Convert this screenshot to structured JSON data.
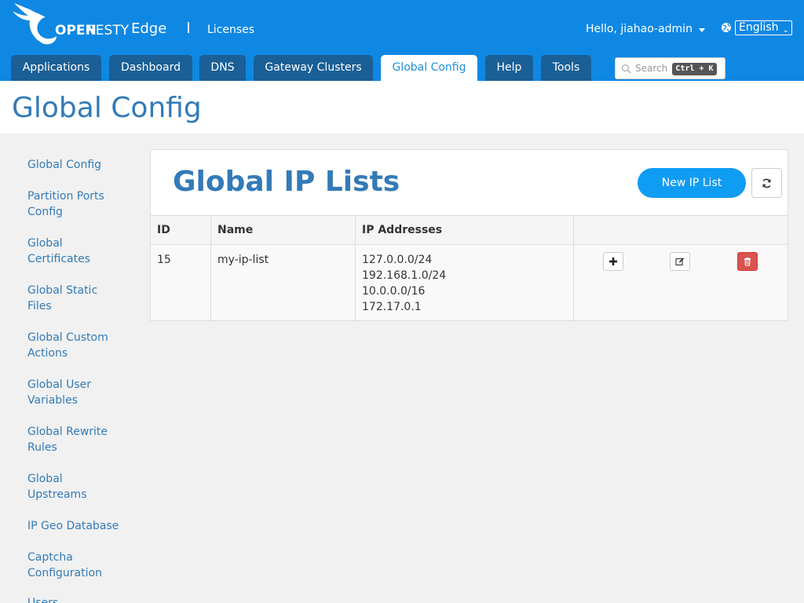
{
  "header": {
    "logo_open": "OPEN",
    "logo_resty": "RESTY",
    "product": "Edge",
    "licenses_link": "Licenses",
    "greeting": "Hello, jiahao-admin",
    "language": "English"
  },
  "tabs": [
    {
      "label": "Applications",
      "active": false
    },
    {
      "label": "Dashboard",
      "active": false
    },
    {
      "label": "DNS",
      "active": false
    },
    {
      "label": "Gateway Clusters",
      "active": false
    },
    {
      "label": "Global Config",
      "active": true
    },
    {
      "label": "Help",
      "active": false
    },
    {
      "label": "Tools",
      "active": false
    }
  ],
  "search": {
    "placeholder": "Search",
    "shortcut": "Ctrl + K"
  },
  "page_title": "Global Config",
  "sidebar": {
    "items": [
      {
        "label": "Global Config"
      },
      {
        "label": "Partition Ports Config"
      },
      {
        "label": "Global Certificates"
      },
      {
        "label": "Global Static Files"
      },
      {
        "label": "Global Custom Actions"
      },
      {
        "label": "Global User Variables"
      },
      {
        "label": "Global Rewrite Rules"
      },
      {
        "label": "Global Upstreams"
      },
      {
        "label": "IP Geo Database"
      },
      {
        "label": "Captcha Configuration"
      },
      {
        "label": "Users"
      }
    ]
  },
  "panel": {
    "title": "Global IP Lists",
    "new_button": "New IP List",
    "table": {
      "columns": [
        "ID",
        "Name",
        "IP Addresses",
        ""
      ],
      "rows": [
        {
          "id": "15",
          "name": "my-ip-list",
          "ips": [
            "127.0.0.0/24",
            "192.168.1.0/24",
            "10.0.0.0/16",
            "172.17.0.1"
          ]
        }
      ]
    }
  },
  "colors": {
    "header_bg": "#0f88e3",
    "tab_bg": "#1a5f96",
    "link": "#337ab7",
    "primary_button": "#0f9cf3",
    "danger": "#d9534f"
  }
}
